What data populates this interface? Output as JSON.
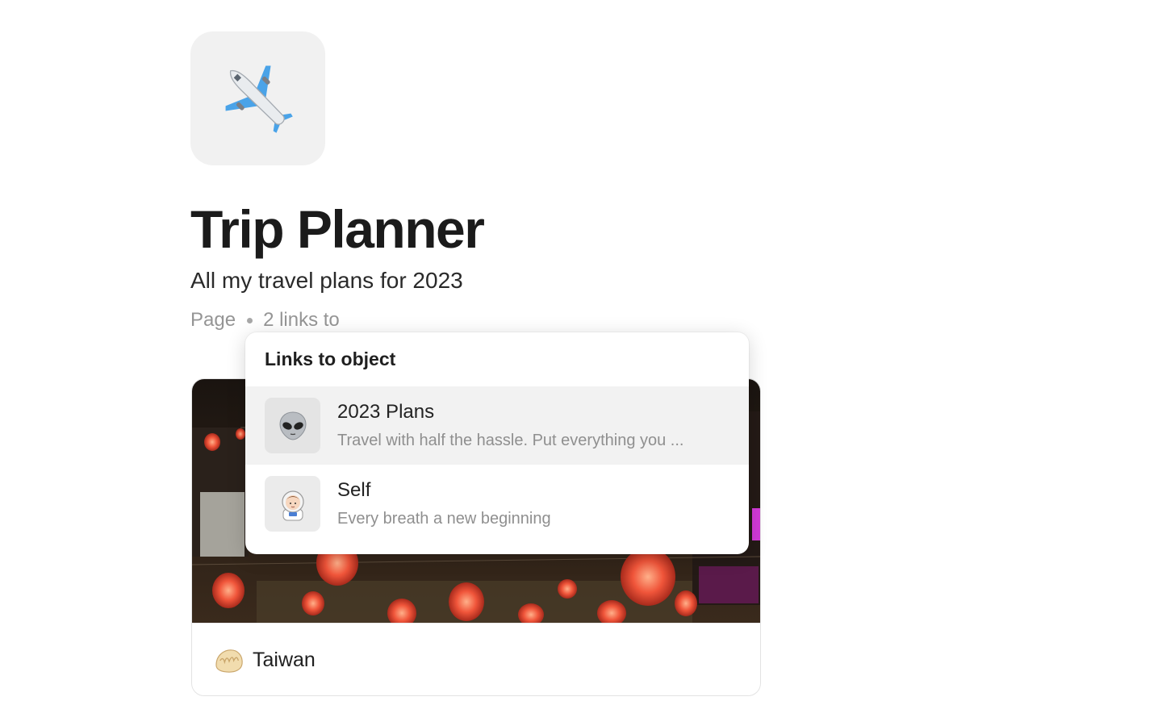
{
  "page": {
    "icon": "airplane-icon",
    "title": "Trip Planner",
    "subtitle": "All my travel plans for 2023",
    "type": "Page",
    "links_label": "2 links to"
  },
  "popover": {
    "title": "Links to object",
    "items": [
      {
        "icon": "alien-icon",
        "title": "2023 Plans",
        "description": "Travel with half the hassle. Put everything you ..."
      },
      {
        "icon": "astronaut-icon",
        "title": "Self",
        "description": "Every breath a new beginning"
      }
    ]
  },
  "card": {
    "icon": "dumpling-icon",
    "title": "Taiwan"
  }
}
